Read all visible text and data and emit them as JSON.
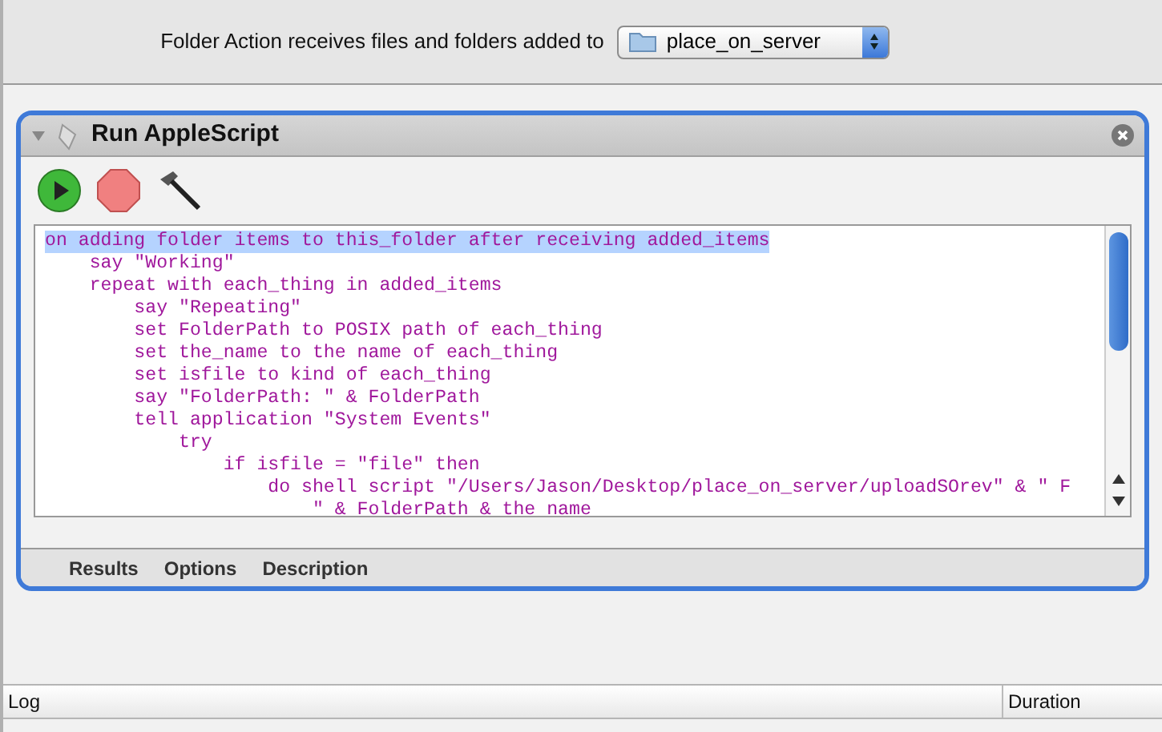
{
  "folder_action": {
    "label": "Folder Action receives files and folders added to",
    "folder_popup": "place_on_server"
  },
  "action": {
    "title": "Run AppleScript",
    "expanded": true,
    "code_lines": [
      {
        "text": "on adding folder items to this_folder after receiving added_items",
        "selected": true
      },
      {
        "text": "    say \"Working\"",
        "selected": false
      },
      {
        "text": "    repeat with each_thing in added_items",
        "selected": false
      },
      {
        "text": "        say \"Repeating\"",
        "selected": false
      },
      {
        "text": "        set FolderPath to POSIX path of each_thing",
        "selected": false
      },
      {
        "text": "        set the_name to the name of each_thing",
        "selected": false
      },
      {
        "text": "        set isfile to kind of each_thing",
        "selected": false
      },
      {
        "text": "        say \"FolderPath: \" & FolderPath",
        "selected": false
      },
      {
        "text": "        tell application \"System Events\"",
        "selected": false
      },
      {
        "text": "            try",
        "selected": false
      },
      {
        "text": "                if isfile = \"file\" then",
        "selected": false
      },
      {
        "text": "                    do shell script \"/Users/Jason/Desktop/place_on_server/uploadSOrev\" & \" F",
        "selected": false
      },
      {
        "text": "                        \" & FolderPath & the name",
        "selected": false
      }
    ],
    "tabs": [
      {
        "label": "Results"
      },
      {
        "label": "Options"
      },
      {
        "label": "Description"
      }
    ]
  },
  "log": {
    "columns": [
      "Log",
      "Duration"
    ]
  }
}
